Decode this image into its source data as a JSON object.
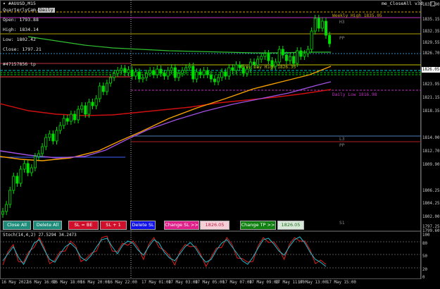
{
  "chart_header": {
    "symbol": "#AUUSD,M15",
    "indicator_name": "QuarterlyCam-Pivots",
    "tag": "Daily",
    "indicator_right": "me_CloseAll v3d"
  },
  "ohlc": {
    "open": "Open: 1793.88",
    "high": "High: 1834.14",
    "low": "Low: 1802.42",
    "close": "Close: 1797.21"
  },
  "order_line_label": "#47157856 tp",
  "levels": {
    "weekly_high": "Weekly High 1835.05",
    "h3": "H3",
    "pp_top": "PP",
    "prev_day_high": "Prev Day High 1826.33",
    "daily_low": "Daily Low 1816.98",
    "l3": "L3",
    "pp": "PP",
    "s1": "S1"
  },
  "price_axis": [
    "1837.90",
    "1835.15",
    "1832.35",
    "1829.55",
    "1826.70",
    "1823.95",
    "1821.15",
    "1818.35",
    "1814.00",
    "1812.70",
    "1809.90",
    "1806.25",
    "1804.25",
    "1802.00",
    "1799.60",
    "1797.25"
  ],
  "current_price_tag": "1826.05",
  "stoch": {
    "label": "Stoch(14,4,2) 27.5294 34.2473",
    "levels": [
      "100",
      "80",
      "50",
      "20",
      "0"
    ]
  },
  "time_axis": [
    "16 May 2022",
    "16 May 16:00",
    "16 May 18:00",
    "16 May 20:00",
    "16 May 22:00",
    "17 May 01:00",
    "17 May 03:00",
    "17 May 05:00",
    "17 May 07:00",
    "17 May 09:00",
    "17 May 11:00",
    "17 May 13:00",
    "17 May 15:00"
  ],
  "buttons": {
    "close_all": "Close All",
    "delete_all": "Delete All",
    "sl_be": "SL = BE",
    "sl_plus": "SL + 1",
    "delete_sl": "Delete SL",
    "change_sl": "Change SL >>",
    "sl_value": "1826.05",
    "change_tp": "Change TP >>",
    "tp_value": "1826.05"
  },
  "colors": {
    "background": "#000000",
    "candle": "#00e000",
    "ma_red": "#d01010",
    "ma_orange": "#f5a000",
    "ma_purple": "#a050e0",
    "ma_green": "#30c030",
    "weekly": "#d0a000",
    "magenta": "#c030c0",
    "blue_line": "#4060ff",
    "stoch_main": "#20c0d0",
    "stoch_signal": "#e02020"
  }
}
